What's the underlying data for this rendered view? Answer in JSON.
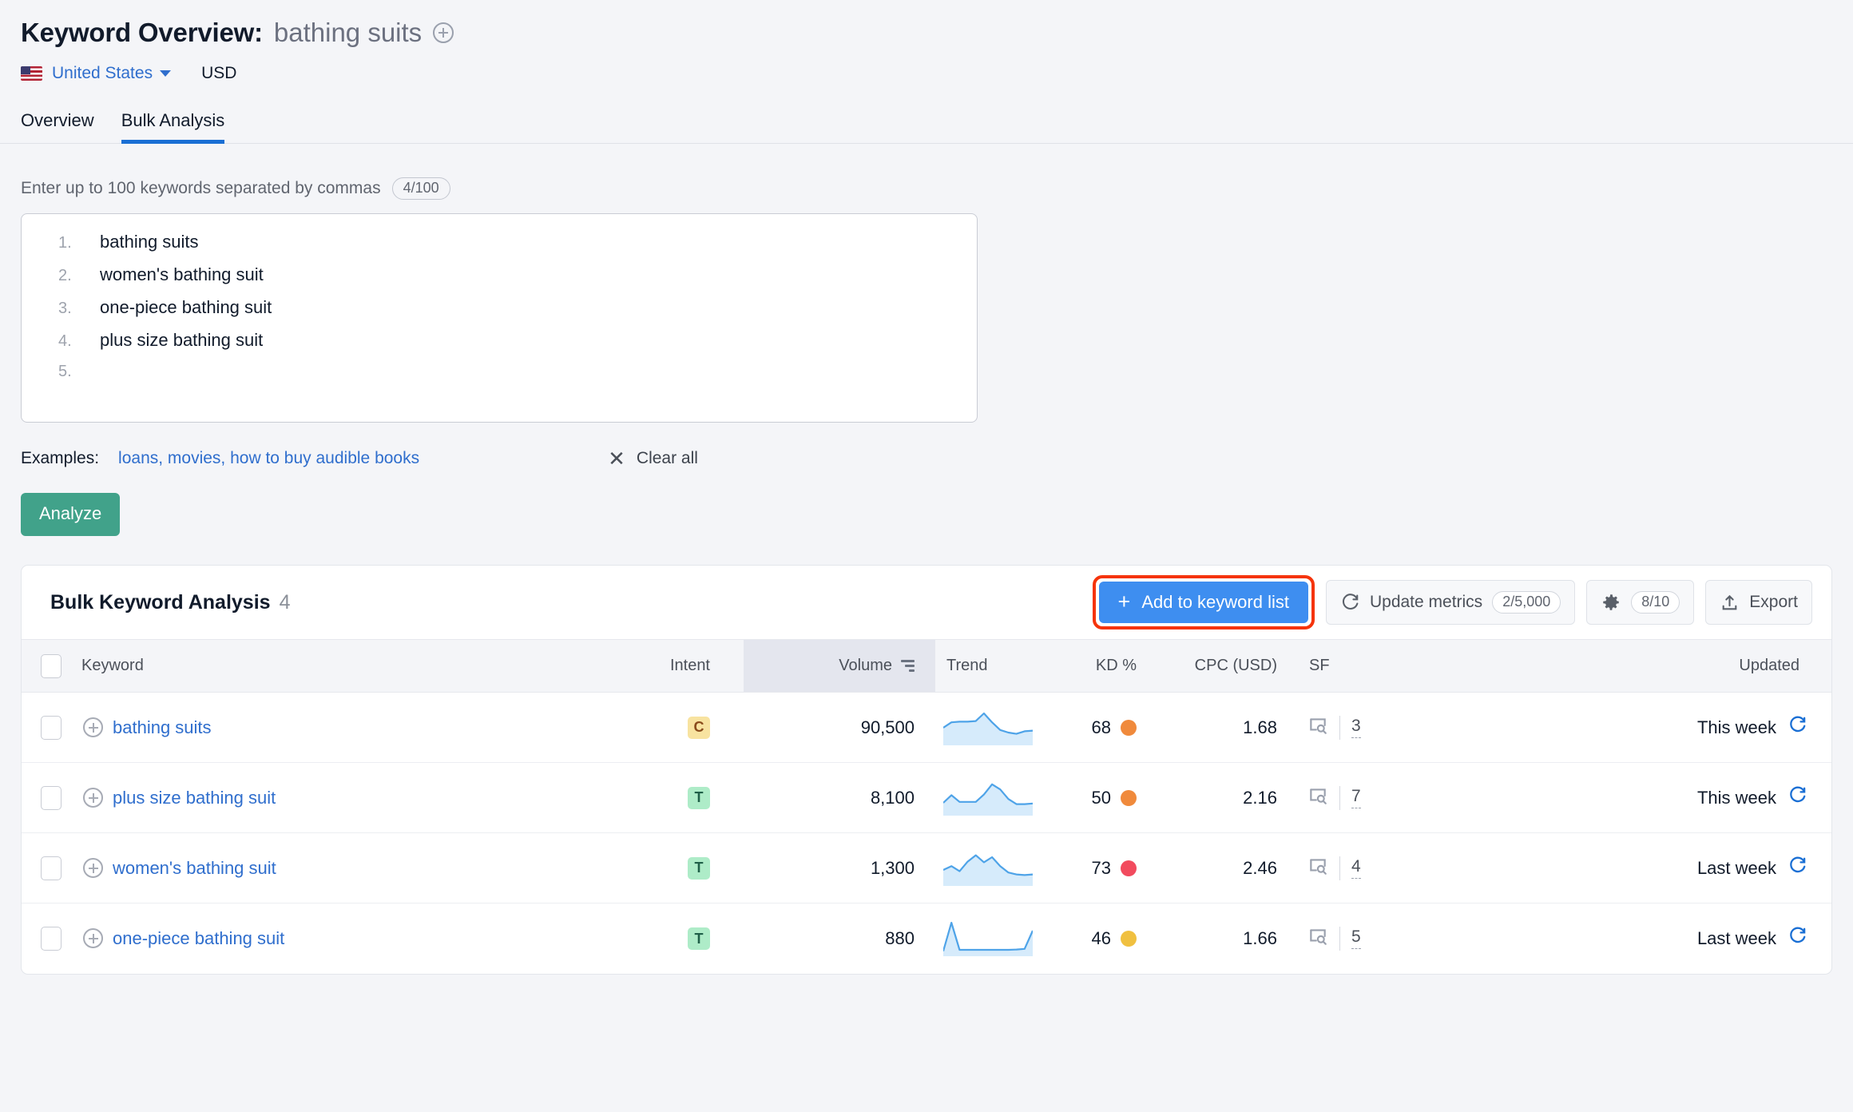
{
  "header": {
    "title_label": "Keyword Overview:",
    "keyword": "bathing suits",
    "add_icon": "plus-circle-icon",
    "country": "United States",
    "currency": "USD"
  },
  "tabs": [
    {
      "label": "Overview",
      "active": false
    },
    {
      "label": "Bulk Analysis",
      "active": true
    }
  ],
  "input_section": {
    "hint": "Enter up to 100 keywords separated by commas",
    "counter": "4/100",
    "keywords": [
      {
        "num": "1.",
        "text": "bathing suits"
      },
      {
        "num": "2.",
        "text": "women's bathing suit"
      },
      {
        "num": "3.",
        "text": "one-piece bathing suit"
      },
      {
        "num": "4.",
        "text": "plus size bathing suit"
      },
      {
        "num": "5.",
        "text": ""
      }
    ],
    "examples_label": "Examples:",
    "examples_links": "loans, movies, how to buy audible books",
    "clear_all": "Clear all",
    "clear_icon": "close-x-icon",
    "analyze_label": "Analyze"
  },
  "results": {
    "title": "Bulk Keyword Analysis",
    "count": "4",
    "add_to_list_label": "Add to keyword list",
    "add_to_list_icon": "plus-icon",
    "update_metrics_label": "Update metrics",
    "update_metrics_badge": "2/5,000",
    "update_metrics_icon": "refresh-icon",
    "settings_badge": "8/10",
    "settings_icon": "gear-icon",
    "export_label": "Export",
    "export_icon": "upload-icon",
    "columns": [
      "Keyword",
      "Intent",
      "Volume",
      "Trend",
      "KD %",
      "CPC (USD)",
      "SF",
      "Updated"
    ],
    "sort_column": "Volume",
    "sort_icon": "sort-descending-icon",
    "rows": [
      {
        "keyword": "bathing suits",
        "intent": "C",
        "intent_type": "commercial",
        "volume": "90,500",
        "kd": "68",
        "kd_color": "#f08a3c",
        "cpc": "1.68",
        "sf": "3",
        "updated": "This week",
        "trend": [
          0.45,
          0.62,
          0.64,
          0.64,
          0.66,
          0.9,
          0.62,
          0.38,
          0.3,
          0.26,
          0.34,
          0.36
        ]
      },
      {
        "keyword": "plus size bathing suit",
        "intent": "T",
        "intent_type": "transactional",
        "volume": "8,100",
        "kd": "50",
        "kd_color": "#f08a3c",
        "cpc": "2.16",
        "sf": "7",
        "updated": "This week",
        "trend": [
          0.3,
          0.54,
          0.33,
          0.33,
          0.33,
          0.56,
          0.88,
          0.72,
          0.42,
          0.26,
          0.26,
          0.28
        ]
      },
      {
        "keyword": "women's bathing suit",
        "intent": "T",
        "intent_type": "transactional",
        "volume": "1,300",
        "kd": "73",
        "kd_color": "#f24b5e",
        "cpc": "2.46",
        "sf": "4",
        "updated": "Last week",
        "trend": [
          0.4,
          0.52,
          0.36,
          0.66,
          0.86,
          0.64,
          0.8,
          0.52,
          0.32,
          0.26,
          0.24,
          0.26
        ]
      },
      {
        "keyword": "one-piece bathing suit",
        "intent": "T",
        "intent_type": "transactional",
        "volume": "880",
        "kd": "46",
        "kd_color": "#f0c040",
        "cpc": "1.66",
        "sf": "5",
        "updated": "Last week",
        "trend": [
          0.06,
          0.95,
          0.1,
          0.1,
          0.1,
          0.1,
          0.1,
          0.1,
          0.1,
          0.11,
          0.13,
          0.7
        ]
      }
    ],
    "row_icons": {
      "add_keyword": "plus-circle-icon",
      "sf_feature": "serp-feature-icon",
      "refresh": "refresh-icon"
    }
  },
  "colors": {
    "accent_blue": "#3e8ef0",
    "link_blue": "#2f6ecd",
    "analyze_green": "#41a28a",
    "highlight_red": "#f5340b",
    "trend_line": "#4ea3e8",
    "trend_fill": "#d6ebfb"
  }
}
